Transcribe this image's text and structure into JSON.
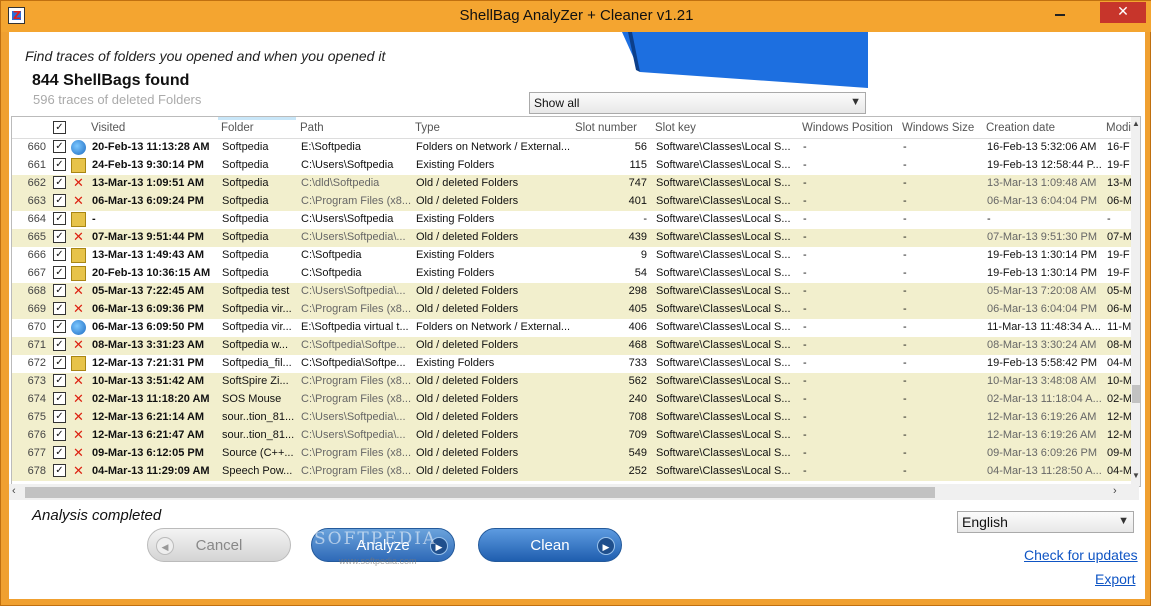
{
  "window": {
    "title": "ShellBag  AnalyZer + Cleaner v1.21",
    "close_glyph": "✕"
  },
  "header": {
    "subtitle": "Find traces of folders you opened and when you opened it",
    "found": "844 ShellBags found",
    "deleted": "596 traces of deleted Folders"
  },
  "filter": {
    "value": "Show all"
  },
  "columns": [
    "Visited",
    "Folder",
    "Path",
    "Type",
    "Slot number",
    "Slot key",
    "Windows Position",
    "Windows Size",
    "Creation date",
    "Modi"
  ],
  "rows": [
    {
      "idx": "660",
      "icon": "network",
      "visited": "20-Feb-13 11:13:28 AM",
      "folder": "Softpedia",
      "path": "E:\\Softpedia",
      "type": "Folders on Network / External...",
      "slot": "56",
      "key": "Software\\Classes\\Local S...",
      "wpos": "-",
      "wsize": "-",
      "cdate": "16-Feb-13 5:32:06 AM",
      "mdate": "16-F"
    },
    {
      "idx": "661",
      "icon": "existing",
      "visited": "24-Feb-13 9:30:14 PM",
      "folder": "Softpedia",
      "path": "C:\\Users\\Softpedia",
      "type": "Existing Folders",
      "slot": "115",
      "key": "Software\\Classes\\Local S...",
      "wpos": "-",
      "wsize": "-",
      "cdate": "19-Feb-13 12:58:44 P...",
      "mdate": "19-F"
    },
    {
      "idx": "662",
      "icon": "deleted",
      "visited": "13-Mar-13 1:09:51 AM",
      "folder": "Softpedia",
      "path": "C:\\dld\\Softpedia",
      "type": "Old / deleted Folders",
      "slot": "747",
      "key": "Software\\Classes\\Local S...",
      "wpos": "-",
      "wsize": "-",
      "cdate": "13-Mar-13 1:09:48 AM",
      "mdate": "13-M"
    },
    {
      "idx": "663",
      "icon": "deleted",
      "visited": "06-Mar-13 6:09:24 PM",
      "folder": "Softpedia",
      "path": "C:\\Program Files (x8...",
      "type": "Old / deleted Folders",
      "slot": "401",
      "key": "Software\\Classes\\Local S...",
      "wpos": "-",
      "wsize": "-",
      "cdate": "06-Mar-13 6:04:04 PM",
      "mdate": "06-M"
    },
    {
      "idx": "664",
      "icon": "existing",
      "visited": "-",
      "folder": "Softpedia",
      "path": "C:\\Users\\Softpedia",
      "type": "Existing Folders",
      "slot": "-",
      "key": "Software\\Classes\\Local S...",
      "wpos": "-",
      "wsize": "-",
      "cdate": "-",
      "mdate": "-"
    },
    {
      "idx": "665",
      "icon": "deleted",
      "visited": "07-Mar-13 9:51:44 PM",
      "folder": "Softpedia",
      "path": "C:\\Users\\Softpedia\\...",
      "type": "Old / deleted Folders",
      "slot": "439",
      "key": "Software\\Classes\\Local S...",
      "wpos": "-",
      "wsize": "-",
      "cdate": "07-Mar-13 9:51:30 PM",
      "mdate": "07-M"
    },
    {
      "idx": "666",
      "icon": "existing",
      "visited": "13-Mar-13 1:49:43 AM",
      "folder": "Softpedia",
      "path": "C:\\Softpedia",
      "type": "Existing Folders",
      "slot": "9",
      "key": "Software\\Classes\\Local S...",
      "wpos": "-",
      "wsize": "-",
      "cdate": "19-Feb-13 1:30:14 PM",
      "mdate": "19-F"
    },
    {
      "idx": "667",
      "icon": "existing",
      "visited": "20-Feb-13 10:36:15 AM",
      "folder": "Softpedia",
      "path": "C:\\Softpedia",
      "type": "Existing Folders",
      "slot": "54",
      "key": "Software\\Classes\\Local S...",
      "wpos": "-",
      "wsize": "-",
      "cdate": "19-Feb-13 1:30:14 PM",
      "mdate": "19-F"
    },
    {
      "idx": "668",
      "icon": "deleted",
      "visited": "05-Mar-13 7:22:45 AM",
      "folder": "Softpedia test",
      "path": "C:\\Users\\Softpedia\\...",
      "type": "Old / deleted Folders",
      "slot": "298",
      "key": "Software\\Classes\\Local S...",
      "wpos": "-",
      "wsize": "-",
      "cdate": "05-Mar-13 7:20:08 AM",
      "mdate": "05-M"
    },
    {
      "idx": "669",
      "icon": "deleted",
      "visited": "06-Mar-13 6:09:36 PM",
      "folder": "Softpedia vir...",
      "path": "C:\\Program Files (x8...",
      "type": "Old / deleted Folders",
      "slot": "405",
      "key": "Software\\Classes\\Local S...",
      "wpos": "-",
      "wsize": "-",
      "cdate": "06-Mar-13 6:04:04 PM",
      "mdate": "06-M"
    },
    {
      "idx": "670",
      "icon": "network",
      "visited": "06-Mar-13 6:09:50 PM",
      "folder": "Softpedia vir...",
      "path": "E:\\Softpedia virtual t...",
      "type": "Folders on Network / External...",
      "slot": "406",
      "key": "Software\\Classes\\Local S...",
      "wpos": "-",
      "wsize": "-",
      "cdate": "11-Mar-13 11:48:34 A...",
      "mdate": "11-M"
    },
    {
      "idx": "671",
      "icon": "deleted",
      "visited": "08-Mar-13 3:31:23 AM",
      "folder": "Softpedia w...",
      "path": "C:\\Softpedia\\Softpe...",
      "type": "Old / deleted Folders",
      "slot": "468",
      "key": "Software\\Classes\\Local S...",
      "wpos": "-",
      "wsize": "-",
      "cdate": "08-Mar-13 3:30:24 AM",
      "mdate": "08-M"
    },
    {
      "idx": "672",
      "icon": "existing",
      "visited": "12-Mar-13 7:21:31 PM",
      "folder": "Softpedia_fil...",
      "path": "C:\\Softpedia\\Softpe...",
      "type": "Existing Folders",
      "slot": "733",
      "key": "Software\\Classes\\Local S...",
      "wpos": "-",
      "wsize": "-",
      "cdate": "19-Feb-13 5:58:42 PM",
      "mdate": "04-M"
    },
    {
      "idx": "673",
      "icon": "deleted",
      "visited": "10-Mar-13 3:51:42 AM",
      "folder": "SoftSpire Zi...",
      "path": "C:\\Program Files (x8...",
      "type": "Old / deleted Folders",
      "slot": "562",
      "key": "Software\\Classes\\Local S...",
      "wpos": "-",
      "wsize": "-",
      "cdate": "10-Mar-13 3:48:08 AM",
      "mdate": "10-M"
    },
    {
      "idx": "674",
      "icon": "deleted",
      "visited": "02-Mar-13 11:18:20 AM",
      "folder": "SOS Mouse",
      "path": "C:\\Program Files (x8...",
      "type": "Old / deleted Folders",
      "slot": "240",
      "key": "Software\\Classes\\Local S...",
      "wpos": "-",
      "wsize": "-",
      "cdate": "02-Mar-13 11:18:04 A...",
      "mdate": "02-M"
    },
    {
      "idx": "675",
      "icon": "deleted",
      "visited": "12-Mar-13 6:21:14 AM",
      "folder": "sour..tion_81...",
      "path": "C:\\Users\\Softpedia\\...",
      "type": "Old / deleted Folders",
      "slot": "708",
      "key": "Software\\Classes\\Local S...",
      "wpos": "-",
      "wsize": "-",
      "cdate": "12-Mar-13 6:19:26 AM",
      "mdate": "12-M"
    },
    {
      "idx": "676",
      "icon": "deleted",
      "visited": "12-Mar-13 6:21:47 AM",
      "folder": "sour..tion_81...",
      "path": "C:\\Users\\Softpedia\\...",
      "type": "Old / deleted Folders",
      "slot": "709",
      "key": "Software\\Classes\\Local S...",
      "wpos": "-",
      "wsize": "-",
      "cdate": "12-Mar-13 6:19:26 AM",
      "mdate": "12-M"
    },
    {
      "idx": "677",
      "icon": "deleted",
      "visited": "09-Mar-13 6:12:05 PM",
      "folder": "Source (C++...",
      "path": "C:\\Program Files (x8...",
      "type": "Old / deleted Folders",
      "slot": "549",
      "key": "Software\\Classes\\Local S...",
      "wpos": "-",
      "wsize": "-",
      "cdate": "09-Mar-13 6:09:26 PM",
      "mdate": "09-M"
    },
    {
      "idx": "678",
      "icon": "deleted",
      "visited": "04-Mar-13 11:29:09 AM",
      "folder": "Speech Pow...",
      "path": "C:\\Program Files (x8...",
      "type": "Old / deleted Folders",
      "slot": "252",
      "key": "Software\\Classes\\Local S...",
      "wpos": "-",
      "wsize": "-",
      "cdate": "04-Mar-13 11:28:50 A...",
      "mdate": "04-M"
    }
  ],
  "status": "Analysis completed",
  "buttons": {
    "cancel": "Cancel",
    "analyze": "Analyze",
    "clean": "Clean"
  },
  "watermark": {
    "main": "SOFTPEDIA",
    "sub": "www.softpedia.com"
  },
  "language": {
    "value": "English"
  },
  "links": {
    "updates": "Check for updates",
    "export": "Export"
  },
  "colors": {
    "accent": "#f4a530",
    "deleted_row": "#f2efcd",
    "link": "#0f55c4",
    "brand_blue": "#1d6fe0"
  }
}
